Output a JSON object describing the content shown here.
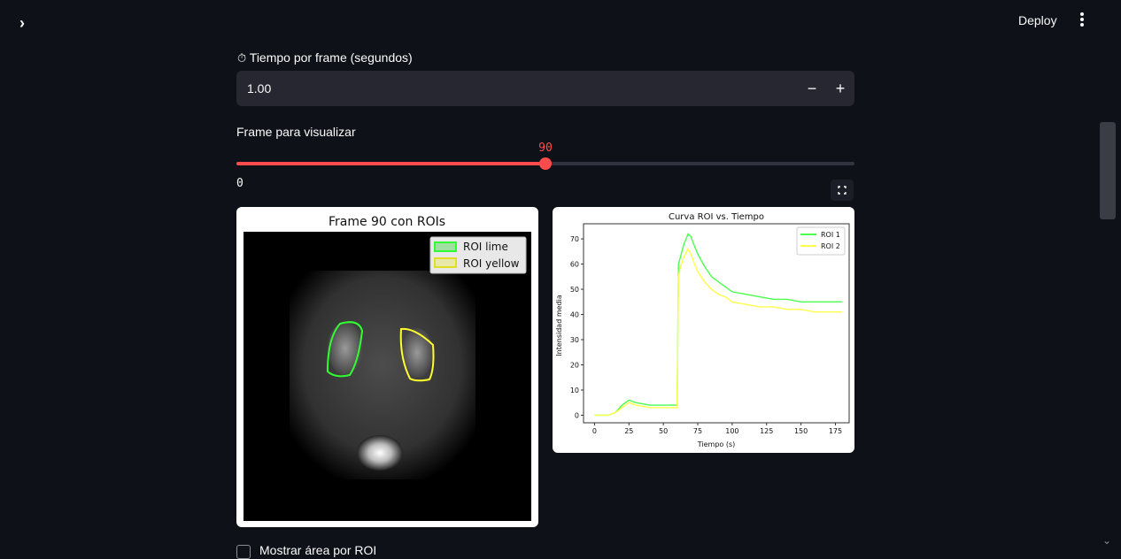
{
  "topbar": {
    "deploy_label": "Deploy",
    "expand_icon": "chevron-right-icon",
    "menu_icon": "kebab-menu-icon"
  },
  "time_per_frame": {
    "icon": "stopwatch-icon",
    "label": "Tiempo por frame (segundos)",
    "value": "1.00",
    "minus_label": "−",
    "plus_label": "+"
  },
  "frame_slider": {
    "label": "Frame para visualizar",
    "value_label": "90",
    "min_label": "0",
    "fill_fraction": 0.5,
    "accent_color": "#ff4b4b"
  },
  "roi_image": {
    "title": "Frame 90 con ROIs",
    "legend": [
      {
        "label": "ROI lime",
        "color": "#32ff32"
      },
      {
        "label": "ROI yellow",
        "color": "#ffff32"
      }
    ]
  },
  "chart_data": {
    "type": "line",
    "title": "Curva ROI vs. Tiempo",
    "xlabel": "Tiempo (s)",
    "ylabel": "Intensidad media",
    "xlim": [
      -8,
      185
    ],
    "ylim": [
      -3,
      76
    ],
    "x_ticks": [
      0,
      25,
      50,
      75,
      100,
      125,
      150,
      175
    ],
    "y_ticks": [
      0,
      10,
      20,
      30,
      40,
      50,
      60,
      70
    ],
    "legend_position": "top-right",
    "series": [
      {
        "name": "ROI 1",
        "color": "#4cff4c",
        "x": [
          0,
          10,
          15,
          20,
          25,
          30,
          40,
          50,
          55,
          60,
          61,
          62,
          65,
          68,
          70,
          72,
          75,
          80,
          85,
          90,
          95,
          100,
          110,
          120,
          130,
          140,
          150,
          160,
          170,
          180
        ],
        "y": [
          0,
          0,
          1,
          4,
          6,
          5,
          4,
          4,
          4,
          4,
          60,
          62,
          68,
          72,
          71,
          68,
          64,
          59,
          55,
          53,
          51,
          49,
          48,
          47,
          46,
          46,
          45,
          45,
          45,
          45
        ]
      },
      {
        "name": "ROI 2",
        "color": "#ffff4c",
        "x": [
          0,
          10,
          15,
          20,
          25,
          30,
          40,
          50,
          55,
          60,
          61,
          62,
          65,
          68,
          70,
          72,
          75,
          80,
          85,
          90,
          95,
          100,
          110,
          120,
          130,
          140,
          150,
          160,
          170,
          180
        ],
        "y": [
          0,
          0,
          1,
          3,
          5,
          4,
          3,
          3,
          3,
          3,
          55,
          58,
          63,
          66,
          64,
          61,
          57,
          53,
          50,
          48,
          47,
          45,
          44,
          43,
          43,
          42,
          42,
          41,
          41,
          41
        ]
      }
    ]
  },
  "show_checkbox": {
    "label": "Mostrar área por ROI"
  }
}
